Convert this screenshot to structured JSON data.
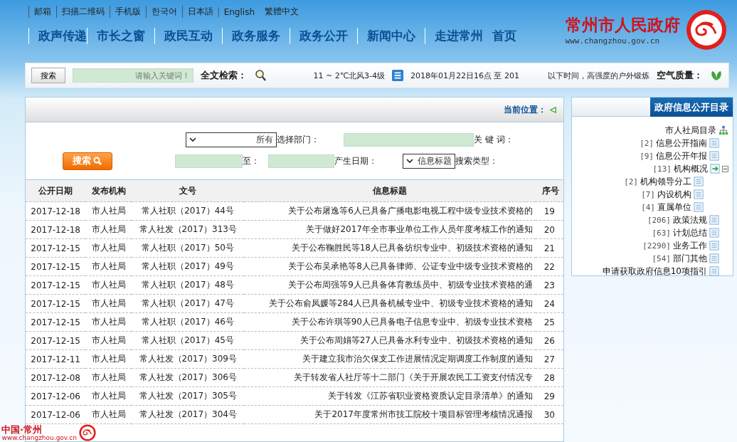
{
  "site": {
    "title": "常州市人民政府",
    "url": "www.changzhou.gov.cn"
  },
  "top_links": [
    "邮箱",
    "扫描二维码",
    "手机版",
    "한국어",
    "日本語",
    "English",
    "繁體中文"
  ],
  "nav": [
    "政声传递",
    "市长之窗",
    "政民互动",
    "政务服务",
    "政务公开",
    "新闻中心",
    "走进常州",
    "首页"
  ],
  "info_bar": {
    "air_label": "空气质量：",
    "air_text": "以下时间，高强度的户外锻炼",
    "time": "2018年01月22日16点 至 201",
    "weather": "11 ~ 2℃北风3-4级",
    "search_label": "全文检索：",
    "search_placeholder": "请输入关键词！",
    "search_button": "搜索"
  },
  "sidebar": {
    "title": "政府信息公开目录",
    "tree": {
      "label": "市人社局目录",
      "children": [
        {
          "label": "信息公开指南",
          "count": "[2]"
        },
        {
          "label": "信息公开年报",
          "count": "[9]"
        },
        {
          "label": "机构概况",
          "count": "[13]",
          "expanded": true,
          "children": [
            {
              "label": "机构领导分工",
              "count": "[2]"
            },
            {
              "label": "内设机构",
              "count": "[7]"
            },
            {
              "label": "直属单位",
              "count": "[4]"
            }
          ]
        },
        {
          "label": "政策法规",
          "count": "[206]"
        },
        {
          "label": "计划总结",
          "count": "[63]"
        },
        {
          "label": "业务工作",
          "count": "[2290]"
        },
        {
          "label": "部门其他",
          "count": "[54]"
        },
        {
          "label": "申请获取政府信息10项指引"
        }
      ]
    }
  },
  "breadcrumb": "当前位置：",
  "form": {
    "keyword_label": "关 键 词：",
    "dept_label": "选择部门：",
    "dept_value": "所有",
    "type_label": "搜索类型：",
    "type_value": "信息标题",
    "date_label": "产生日期：",
    "to_label": "至：",
    "button": "搜索"
  },
  "table": {
    "columns": [
      "公开日期",
      "发布机构",
      "文号",
      "信息标题",
      "序号"
    ],
    "rows": [
      [
        "2017-12-18",
        "市人社局",
        "常人社职（2017）44号",
        "关于公布屠逸等6人已具备广播电影电视工程中级专业技术资格的",
        "19"
      ],
      [
        "2017-12-18",
        "市人社局",
        "常人社发（2017）313号",
        "关于做好2017年全市事业单位工作人员年度考核工作的通知",
        "20"
      ],
      [
        "2017-12-15",
        "市人社局",
        "常人社职（2017）50号",
        "关于公布鞠胜民等18人已具备纺织专业中、初级技术资格的通知",
        "21"
      ],
      [
        "2017-12-15",
        "市人社局",
        "常人社职（2017）49号",
        "关于公布吴承艳等8人已具备律师、公证专业中级专业技术资格的",
        "22"
      ],
      [
        "2017-12-15",
        "市人社局",
        "常人社职（2017）48号",
        "关于公布周强等9人已具备体育教练员中、初级专业技术资格的通",
        "23"
      ],
      [
        "2017-12-15",
        "市人社局",
        "常人社职（2017）47号",
        "关于公布俞凤媛等284人已具备机械专业中、初级专业技术资格的通知",
        "24"
      ],
      [
        "2017-12-15",
        "市人社局",
        "常人社职（2017）46号",
        "关于公布许琪等90人已具备电子信息专业中、初级专业技术资格",
        "25"
      ],
      [
        "2017-12-15",
        "市人社局",
        "常人社职（2017）45号",
        "关于公布周娟等27人已具备水利专业中、初级技术资格的通知",
        "26"
      ],
      [
        "2017-12-11",
        "市人社局",
        "常人社发（2017）309号",
        "关于建立我市治欠保支工作进展情况定期调度工作制度的通知",
        "27"
      ],
      [
        "2017-12-08",
        "市人社局",
        "常人社发（2017）306号",
        "关于转发省人社厅等十二部门《关于开展农民工工资支付情况专",
        "28"
      ],
      [
        "2017-12-06",
        "市人社局",
        "常人社发（2017）305号",
        "关于转发《江苏省职业资格资质认定目录清单》的通知",
        "29"
      ],
      [
        "2017-12-06",
        "市人社局",
        "常人社发（2017）304号",
        "关于2017年度常州市技工院校十项目标管理考核情况通报",
        "30"
      ]
    ]
  },
  "badge": {
    "title": "中国·常州",
    "url": "www.changzhou.gov.cn"
  }
}
